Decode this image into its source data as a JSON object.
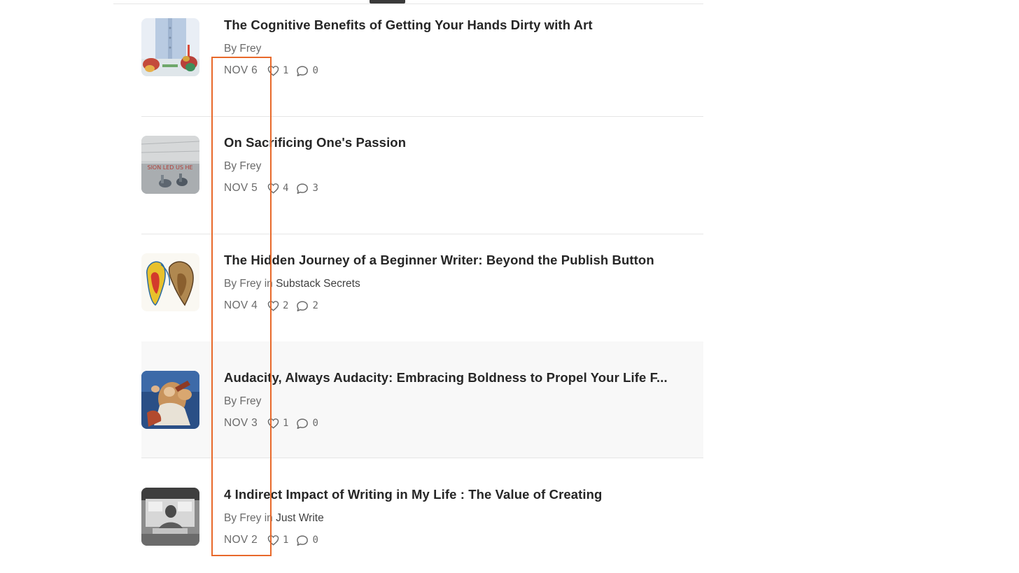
{
  "posts": [
    {
      "title": "The Cognitive Benefits of Getting Your Hands Dirty with Art",
      "author_prefix": "By Frey",
      "in_word": "",
      "publication": "",
      "date": "NOV 6",
      "likes": "1",
      "comments": "0",
      "thumb_icon": "hands-painting-thumbnail"
    },
    {
      "title": "On Sacrificing One's Passion",
      "author_prefix": "By Frey",
      "in_word": "",
      "publication": "",
      "date": "NOV 5",
      "likes": "4",
      "comments": "3",
      "thumb_icon": "passion-graffiti-thumbnail",
      "thumb_text": "SION LED US HE"
    },
    {
      "title": "The Hidden Journey of a Beginner Writer: Beyond the Publish Button",
      "author_prefix": "By Frey",
      "in_word": " in ",
      "publication": "Substack Secrets",
      "date": "NOV 4",
      "likes": "2",
      "comments": "2",
      "thumb_icon": "abstract-hands-thumbnail"
    },
    {
      "title": "Audacity, Always Audacity: Embracing Boldness to Propel Your Life F...",
      "author_prefix": "By Frey",
      "in_word": "",
      "publication": "",
      "date": "NOV 3",
      "likes": "1",
      "comments": "0",
      "thumb_icon": "baroque-painting-thumbnail"
    },
    {
      "title": "4 Indirect Impact of Writing in My Life : The Value of Creating",
      "author_prefix": "By Frey",
      "in_word": " in ",
      "publication": "Just Write",
      "date": "NOV 2",
      "likes": "1",
      "comments": "0",
      "thumb_icon": "vintage-photo-thumbnail"
    }
  ],
  "colors": {
    "highlight": "#e8692a",
    "text_primary": "#262626",
    "text_secondary": "#6b6b6b",
    "divider": "#e6e6e6",
    "hover_bg": "#f8f8f8"
  },
  "icons": {
    "like": "heart-icon",
    "comment": "comment-bubble-icon"
  }
}
